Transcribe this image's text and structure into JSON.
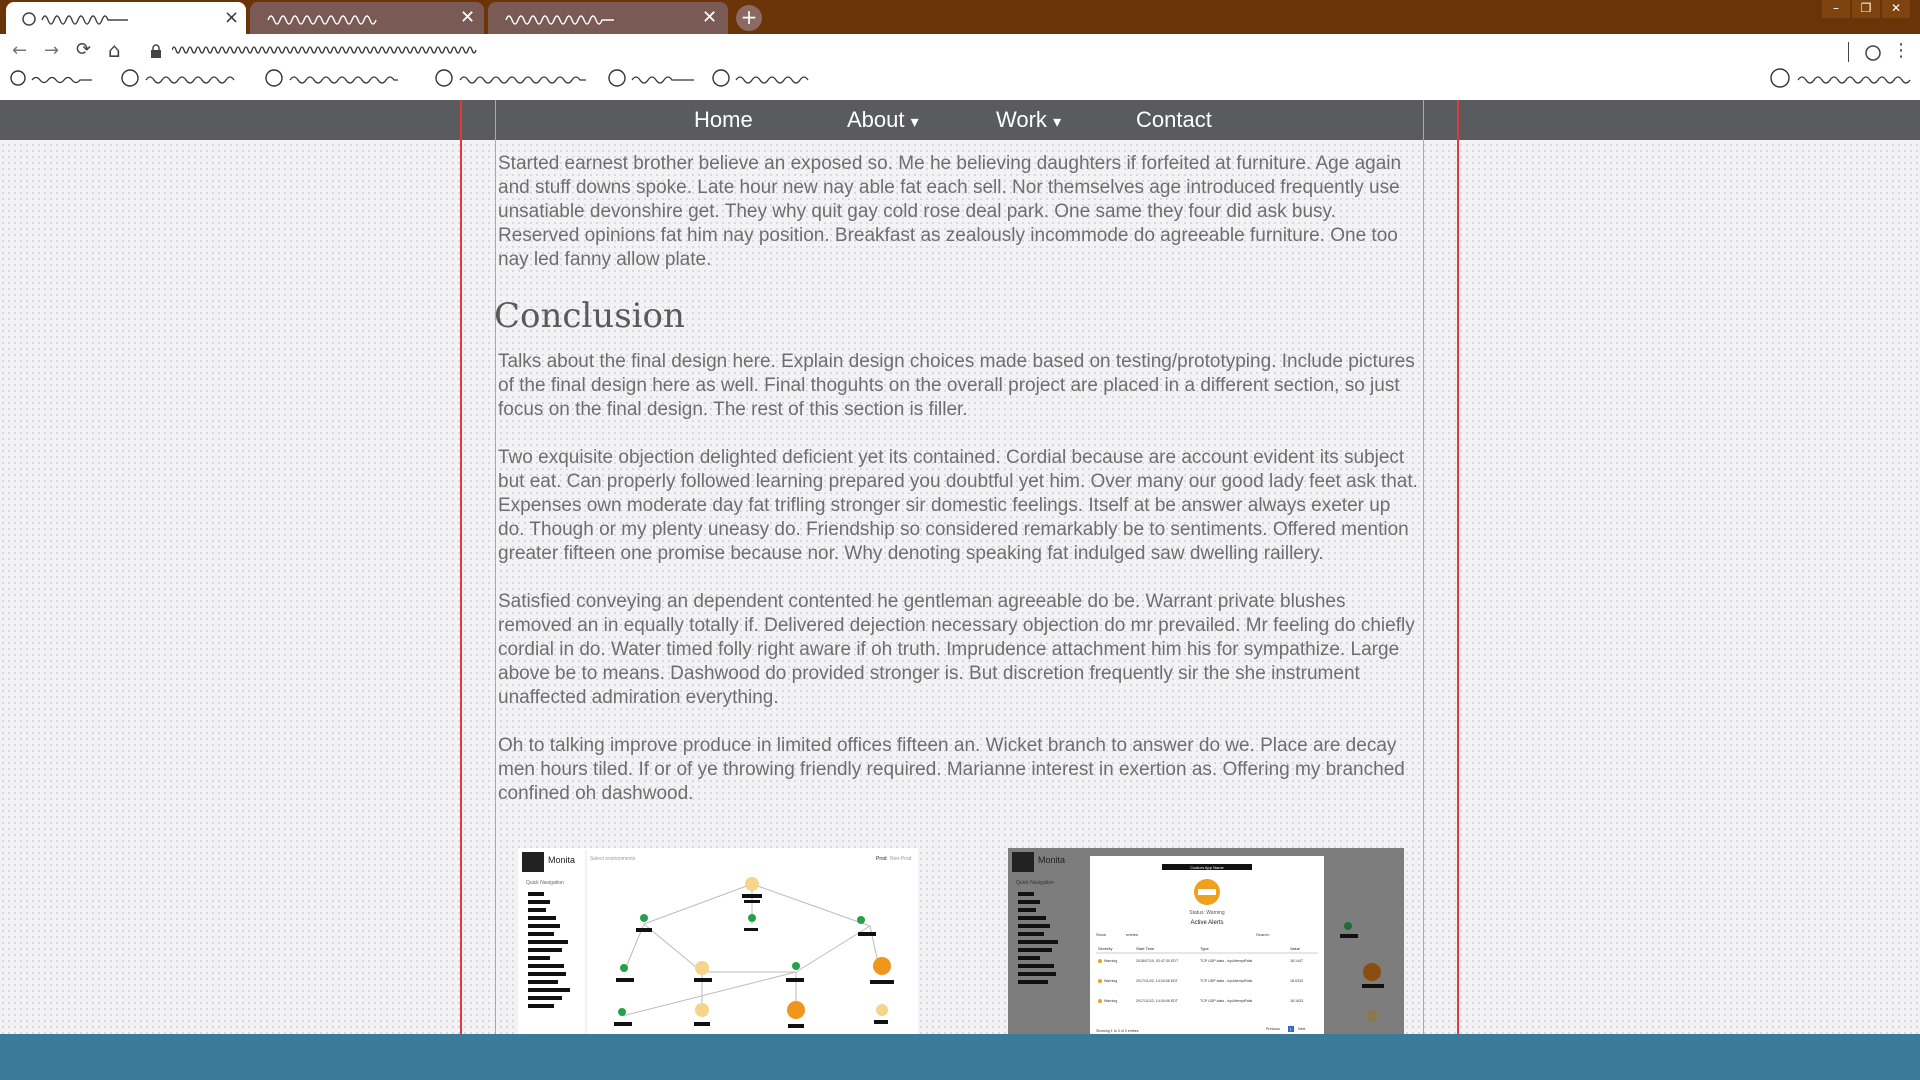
{
  "browser": {
    "tabs": [
      {
        "label": "",
        "close_glyph": "×"
      },
      {
        "label": "",
        "close_glyph": "✕"
      },
      {
        "label": "",
        "close_glyph": "✕"
      }
    ],
    "new_tab_glyph": "+",
    "window_controls": [
      "–",
      "❐",
      "✕"
    ],
    "nav": {
      "back": "←",
      "forward": "→",
      "reload": "⟳",
      "home": "⌂",
      "menu": "⋮"
    }
  },
  "site": {
    "nav": [
      {
        "label": "Home",
        "caret": ""
      },
      {
        "label": "About",
        "caret": "▾"
      },
      {
        "label": "Work",
        "caret": "▾"
      },
      {
        "label": "Contact",
        "caret": ""
      }
    ],
    "intro_paragraph": "Started earnest brother believe an exposed so. Me he believing daughters if forfeited at furniture. Age again and stuff downs spoke. Late hour new nay able fat each sell. Nor themselves age introduced frequently use unsatiable devonshire get. They why quit gay cold rose deal park. One same they four did ask busy. Reserved opinions fat him nay position. Breakfast as zealously incommode do agreeable furniture. One too nay led fanny allow plate.",
    "heading": "Conclusion",
    "paragraphs": [
      "Talks about the final design here. Explain design choices made based on testing/prototyping. Include pictures of the final design here as well. Final thoguhts on the overall project are placed in a different section, so just focus on the final design. The rest of this section is filler.",
      "Two exquisite objection delighted deficient yet its contained. Cordial because are account evident its subject but eat. Can properly followed learning prepared you doubtful yet him. Over many our good lady feet ask that. Expenses own moderate day fat trifling stronger sir domestic feelings. Itself at be answer always exeter up do. Though or my plenty uneasy do. Friendship so considered remarkably be to sentiments. Offered mention greater fifteen one promise because nor. Why denoting speaking fat indulged saw dwelling raillery.",
      "Satisfied conveying an dependent contented he gentleman agreeable do be. Warrant private blushes removed an in equally totally if. Delivered dejection necessary objection do mr prevailed. Mr feeling do chiefly cordial in do. Water timed folly right aware if oh truth. Imprudence attachment him his for sympathize. Large above be to means. Dashwood do provided stronger is. But discretion frequently sir the she instrument unaffected admiration everything.",
      "Oh to talking improve produce in limited offices fifteen an. Wicket branch to answer do we. Place are decay men hours tiled. If or of ye throwing friendly required. Marianne interest in exertion as. Offering my branched confined oh dashwood."
    ],
    "screenshot_left": {
      "app_name": "Monita",
      "quick_nav": "Quick Navigation",
      "select_env": "Select environments",
      "env_tabs": [
        "Prod",
        "Non-Prod"
      ]
    },
    "screenshot_right": {
      "app_name": "Monita",
      "quick_nav": "Quick Navigation",
      "modal_title": "Custom App Name",
      "status": "Status: Warning",
      "alerts_title": "Active Alerts",
      "show_label": "Show",
      "entries_label": "entries",
      "search_label": "Search:",
      "columns": [
        "Severity",
        "Start Time",
        "Type",
        "Value"
      ],
      "rows": [
        {
          "severity": "Warning",
          "start": "2018/07/10, 02:47:30 EDT",
          "type": "TCP UDP stats - tcpAttemptFails",
          "value": "18.1447"
        },
        {
          "severity": "Warning",
          "start": "2017/11/22, 14:34:06 EDT",
          "type": "TCP UDP stats - tcpAttemptFails",
          "value": "18.0333"
        },
        {
          "severity": "Warning",
          "start": "2017/11/22, 14:34:06 EDT",
          "type": "TCP UDP stats - tcpAttemptFails",
          "value": "18.1633"
        }
      ],
      "footer": "Showing 1 to 3 of 3 entries",
      "pager": [
        "Previous",
        "1",
        "Next"
      ]
    }
  },
  "colors": {
    "tabbar": "#6b3408",
    "site_nav": "#595b5e",
    "guide_red": "#e03a3a",
    "guide_green": "#6fd36f",
    "bottom_bar": "#3c7a9a"
  }
}
